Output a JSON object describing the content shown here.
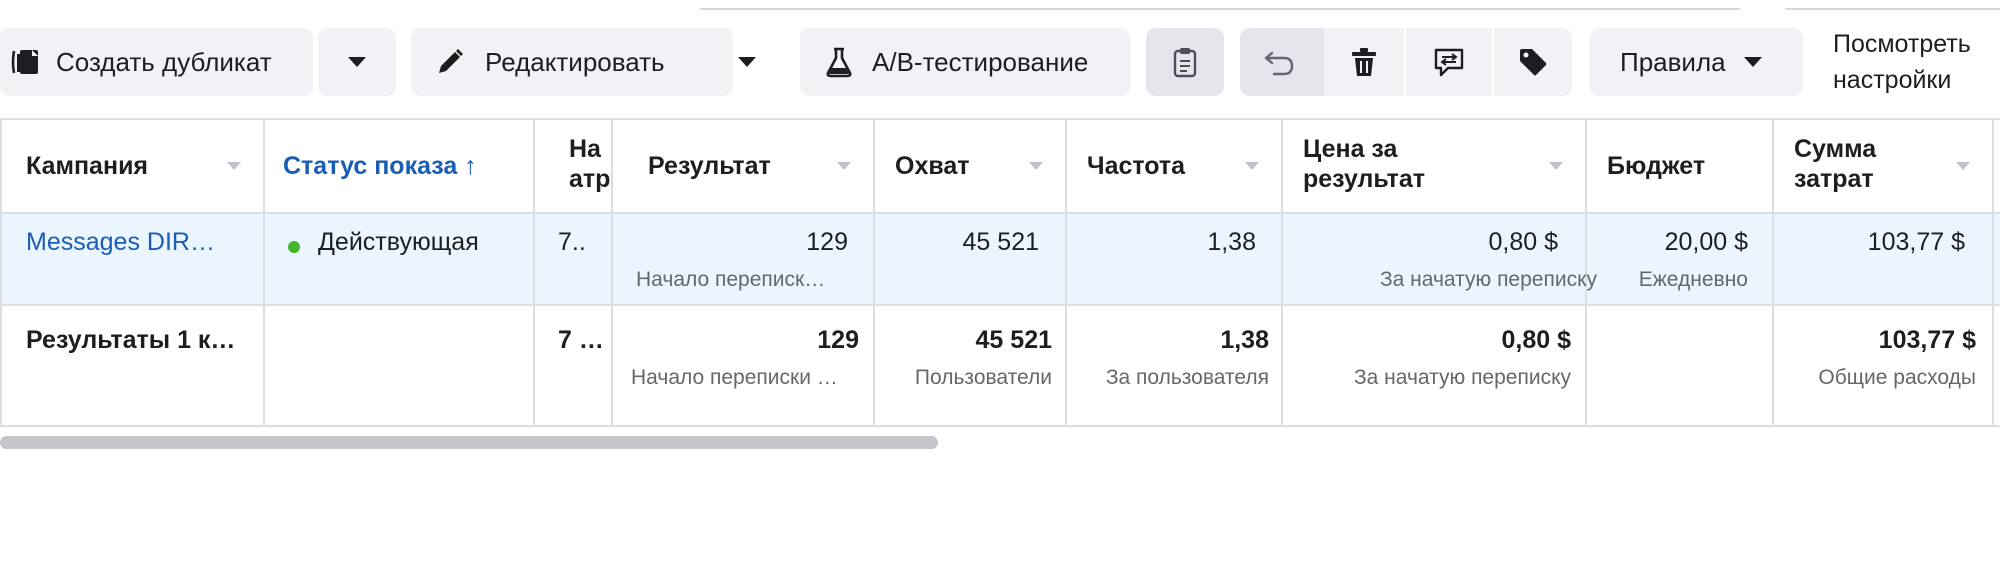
{
  "toolbar": {
    "duplicate_label": "Создать дубликат",
    "edit_label": "Редактировать",
    "ab_test_label": "A/B-тестирование",
    "rules_label": "Правила",
    "view_settings_line1": "Посмотреть",
    "view_settings_line2": "настройки"
  },
  "icons": [
    "duplicate-icon",
    "caret-down-icon",
    "pencil-icon",
    "flask-icon",
    "clipboard-icon",
    "undo-icon",
    "trash-icon",
    "swap-icon",
    "tag-icon"
  ],
  "table": {
    "columns": [
      {
        "label": "Кампания"
      },
      {
        "label": "Статус показа ↑",
        "active": true
      },
      {
        "label_line1": "На",
        "label_line2": "атр"
      },
      {
        "label": "Результат"
      },
      {
        "label": "Охват"
      },
      {
        "label": "Частота"
      },
      {
        "label_line1": "Цена за",
        "label_line2": "результат"
      },
      {
        "label": "Бюджет"
      },
      {
        "label_line1": "Сумма",
        "label_line2": "затрат"
      }
    ],
    "row": {
      "campaign": "Messages DIR…",
      "status": "Действующая",
      "attr": "7..",
      "result": "129",
      "result_sub": "Начало переписк…",
      "reach": "45 521",
      "frequency": "1,38",
      "cost_per_result": "0,80 $",
      "cost_per_result_sub": "За начатую переписку",
      "budget": "20,00 $",
      "budget_sub": "Ежедневно",
      "spend": "103,77 $"
    },
    "summary": {
      "label": "Результаты 1 к…",
      "attr": "7 …",
      "result": "129",
      "result_sub": "Начало переписки …",
      "reach": "45 521",
      "reach_sub": "Пользователи",
      "frequency": "1,38",
      "frequency_sub": "За пользователя",
      "cost_per_result": "0,80 $",
      "cost_per_result_sub": "За начатую переписку",
      "spend": "103,77 $",
      "spend_sub": "Общие расходы"
    }
  },
  "colors": {
    "accent": "#1a5db4",
    "status_dot": "#42b72a",
    "row_highlight": "#ebf5ff",
    "button_bg": "#f0f2f5"
  }
}
